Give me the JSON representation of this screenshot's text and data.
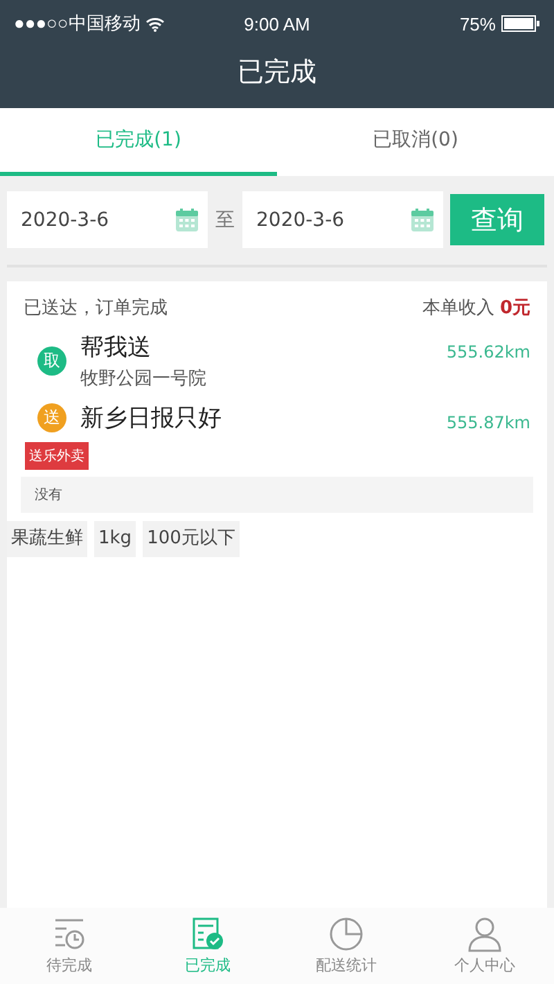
{
  "status_bar": {
    "carrier": "●●●○○中国移动",
    "time": "9:00 AM",
    "battery": "75%"
  },
  "title": "已完成",
  "tabs": [
    {
      "label": "已完成(1)",
      "selected": true
    },
    {
      "label": "已取消(0)",
      "selected": false
    }
  ],
  "filter": {
    "start_date": "2020-3-6",
    "separator": "至",
    "end_date": "2020-3-6",
    "button": "查询"
  },
  "order": {
    "status": "已送达，订单完成",
    "income_label": "本单收入",
    "income": "0元",
    "stops": [
      {
        "badge": "取",
        "color": "#1dbb85",
        "name": "帮我送",
        "address": "牧野公园一号院",
        "distance": "555.62km"
      },
      {
        "badge": "送",
        "color": "#f0a020",
        "name": "新乡日报只好",
        "distance": "555.87km"
      }
    ],
    "tag": "送乐外卖",
    "note": "没有",
    "attributes": [
      "果蔬生鲜",
      "1kg",
      "100元以下"
    ]
  },
  "nav": [
    {
      "label": "待完成",
      "selected": false
    },
    {
      "label": "已完成",
      "selected": true
    },
    {
      "label": "配送统计",
      "selected": false
    },
    {
      "label": "个人中心",
      "selected": false
    }
  ]
}
